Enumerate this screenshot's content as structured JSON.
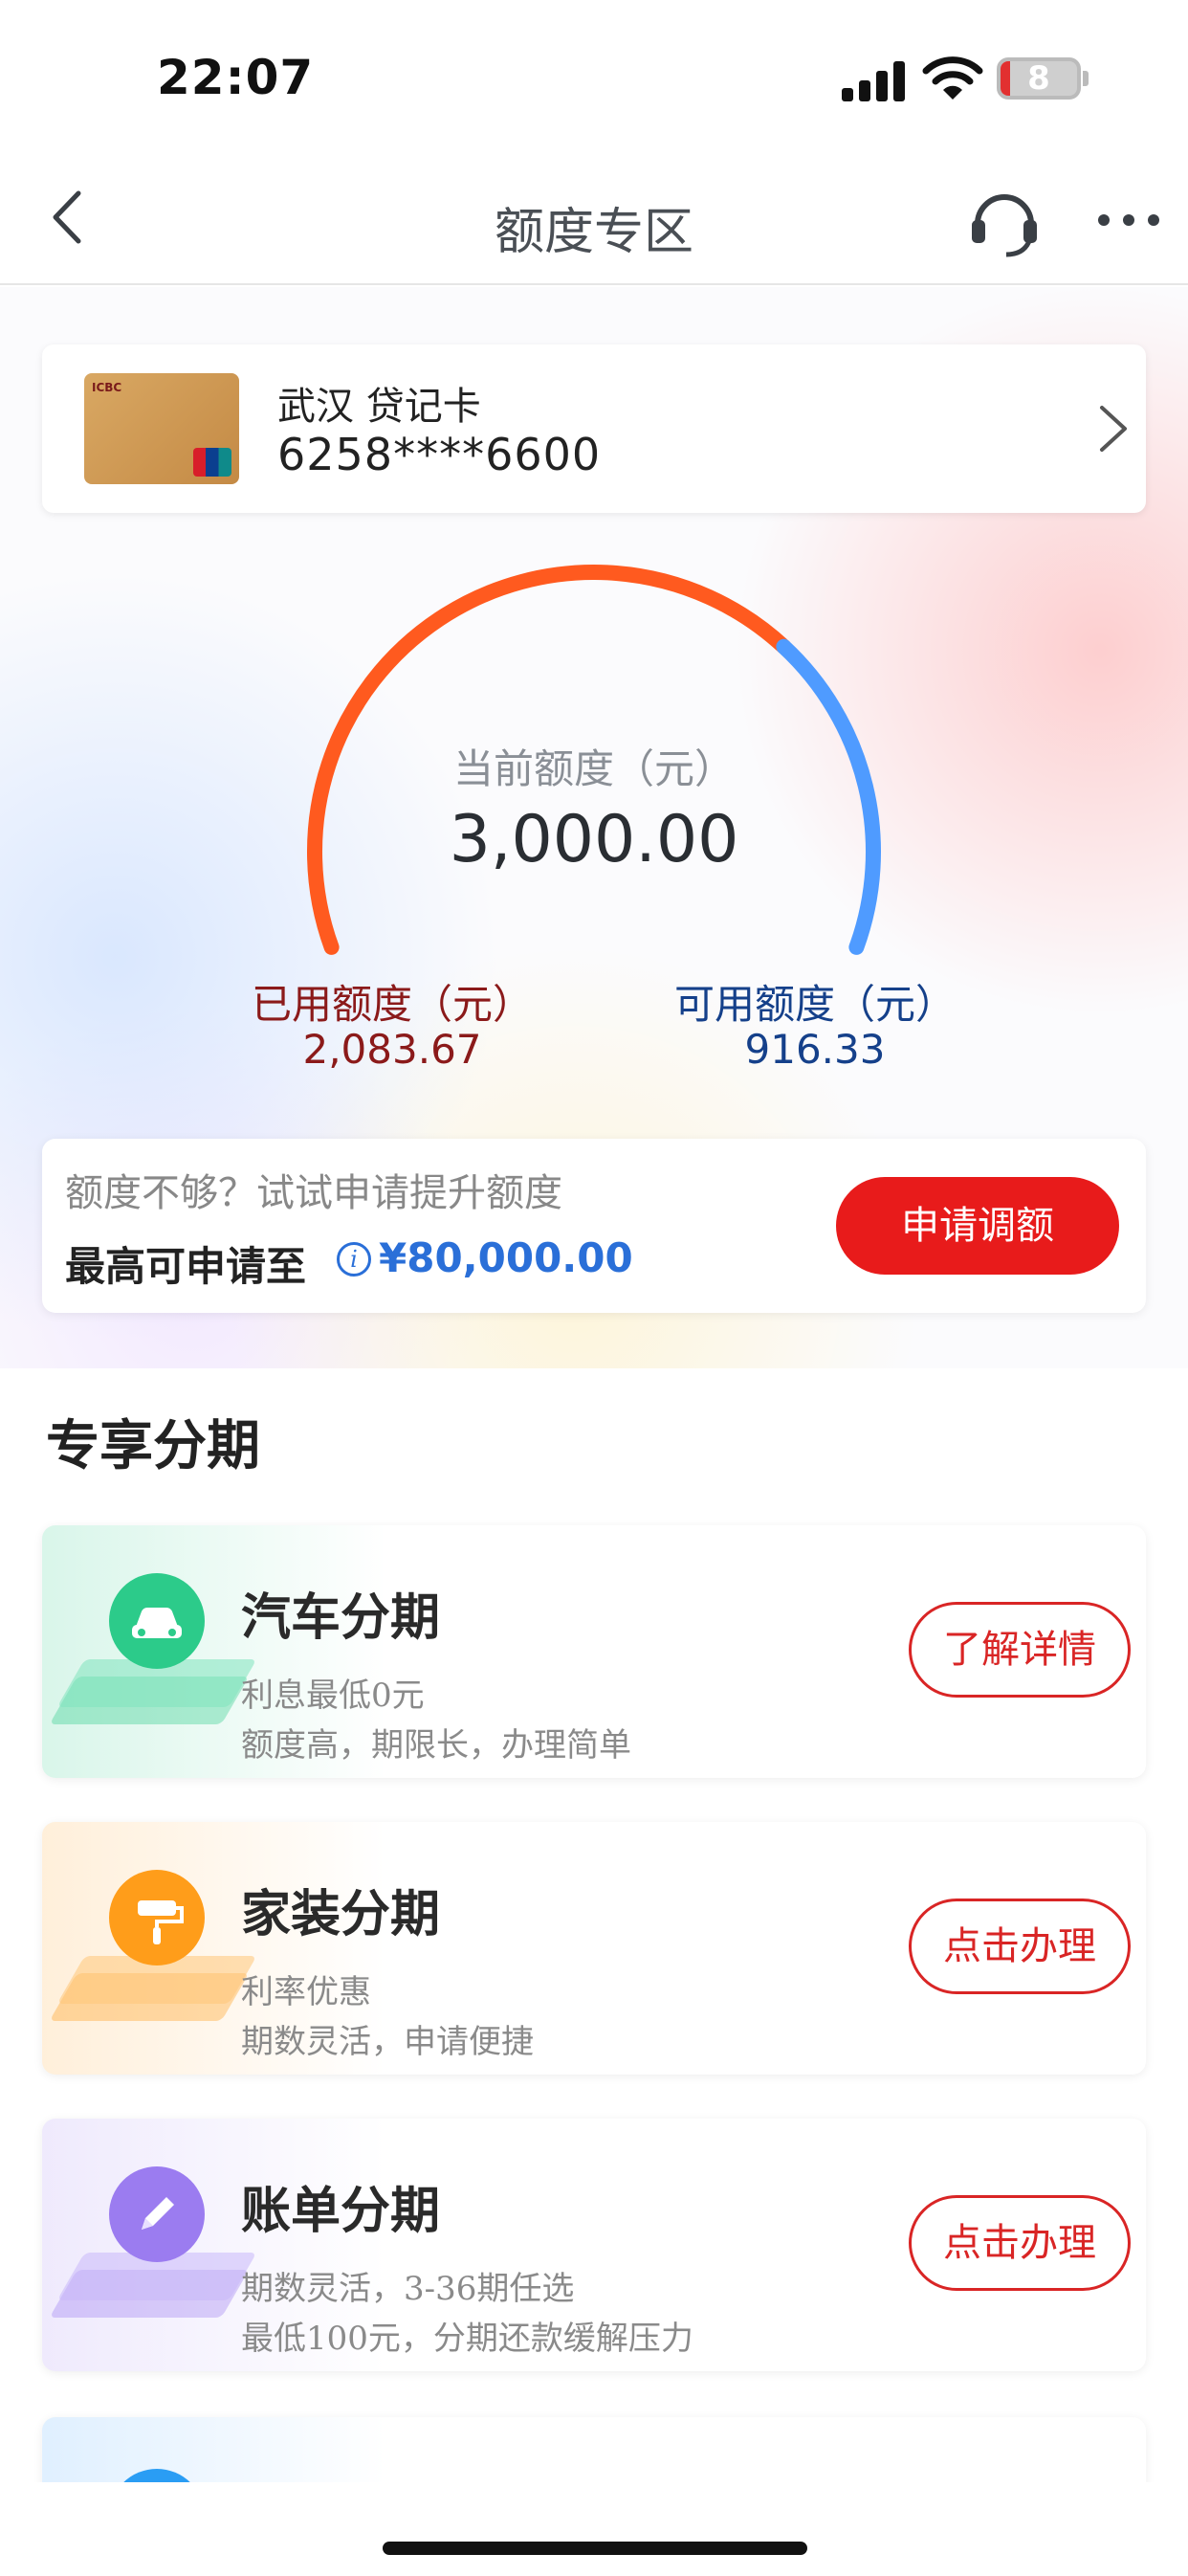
{
  "status_bar": {
    "time": "22:07",
    "battery": "8"
  },
  "nav": {
    "title": "额度专区"
  },
  "card": {
    "title": "武汉 贷记卡",
    "number": "6258****6600"
  },
  "limit": {
    "current_label": "当前额度（元）",
    "current_value": "3,000.00",
    "used_label": "已用额度（元）",
    "used_value": "2,083.67",
    "available_label": "可用额度（元）",
    "available_value": "916.33",
    "used_fraction": 0.6946,
    "available_fraction": 0.3054,
    "colors": {
      "used": "#ff5a1f",
      "available": "#4f9bff"
    }
  },
  "raise": {
    "tip": "额度不够？试试申请提升额度",
    "max_label": "最高可申请至",
    "max_amount": "¥80,000.00",
    "button": "申请调额"
  },
  "section": {
    "title": "专享分期"
  },
  "promos": [
    {
      "title": "汽车分期",
      "line1": "利息最低0元",
      "line2": "额度高，期限长，办理简单",
      "button": "了解详情",
      "icon": "car-icon",
      "color": "#2ccb8a"
    },
    {
      "title": "家装分期",
      "line1": "利率优惠",
      "line2": "期数灵活，申请便捷",
      "button": "点击办理",
      "icon": "paint-roller-icon",
      "color": "#ff9d1a"
    },
    {
      "title": "账单分期",
      "line1": "期数灵活，3-36期任选",
      "line2": "最低100元，分期还款缓解压力",
      "button": "点击办理",
      "icon": "pencil-icon",
      "color": "#9b7cf0"
    }
  ]
}
